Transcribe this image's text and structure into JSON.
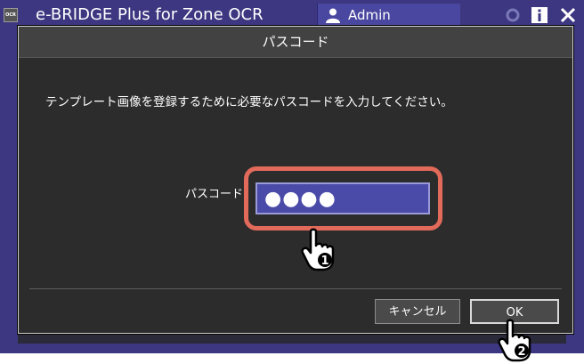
{
  "app": {
    "title": "e-BRIDGE Plus for Zone OCR",
    "logo_text": "OCR",
    "user": "Admin",
    "accent": "#3c3780"
  },
  "dialog": {
    "title": "パスコード",
    "message": "テンプレート画像を登録するために必要なパスコードを入力してください。",
    "passcode_label": "パスコード",
    "passcode_value": "●●●●",
    "cancel_label": "キャンセル",
    "ok_label": "OK"
  },
  "callouts": {
    "step1": "1",
    "step2": "2",
    "highlight_color": "#e26a5a"
  },
  "icons": [
    "ocr-logo-icon",
    "user-icon",
    "settings-icon",
    "info-icon",
    "close-icon",
    "pointing-hand-icon"
  ]
}
